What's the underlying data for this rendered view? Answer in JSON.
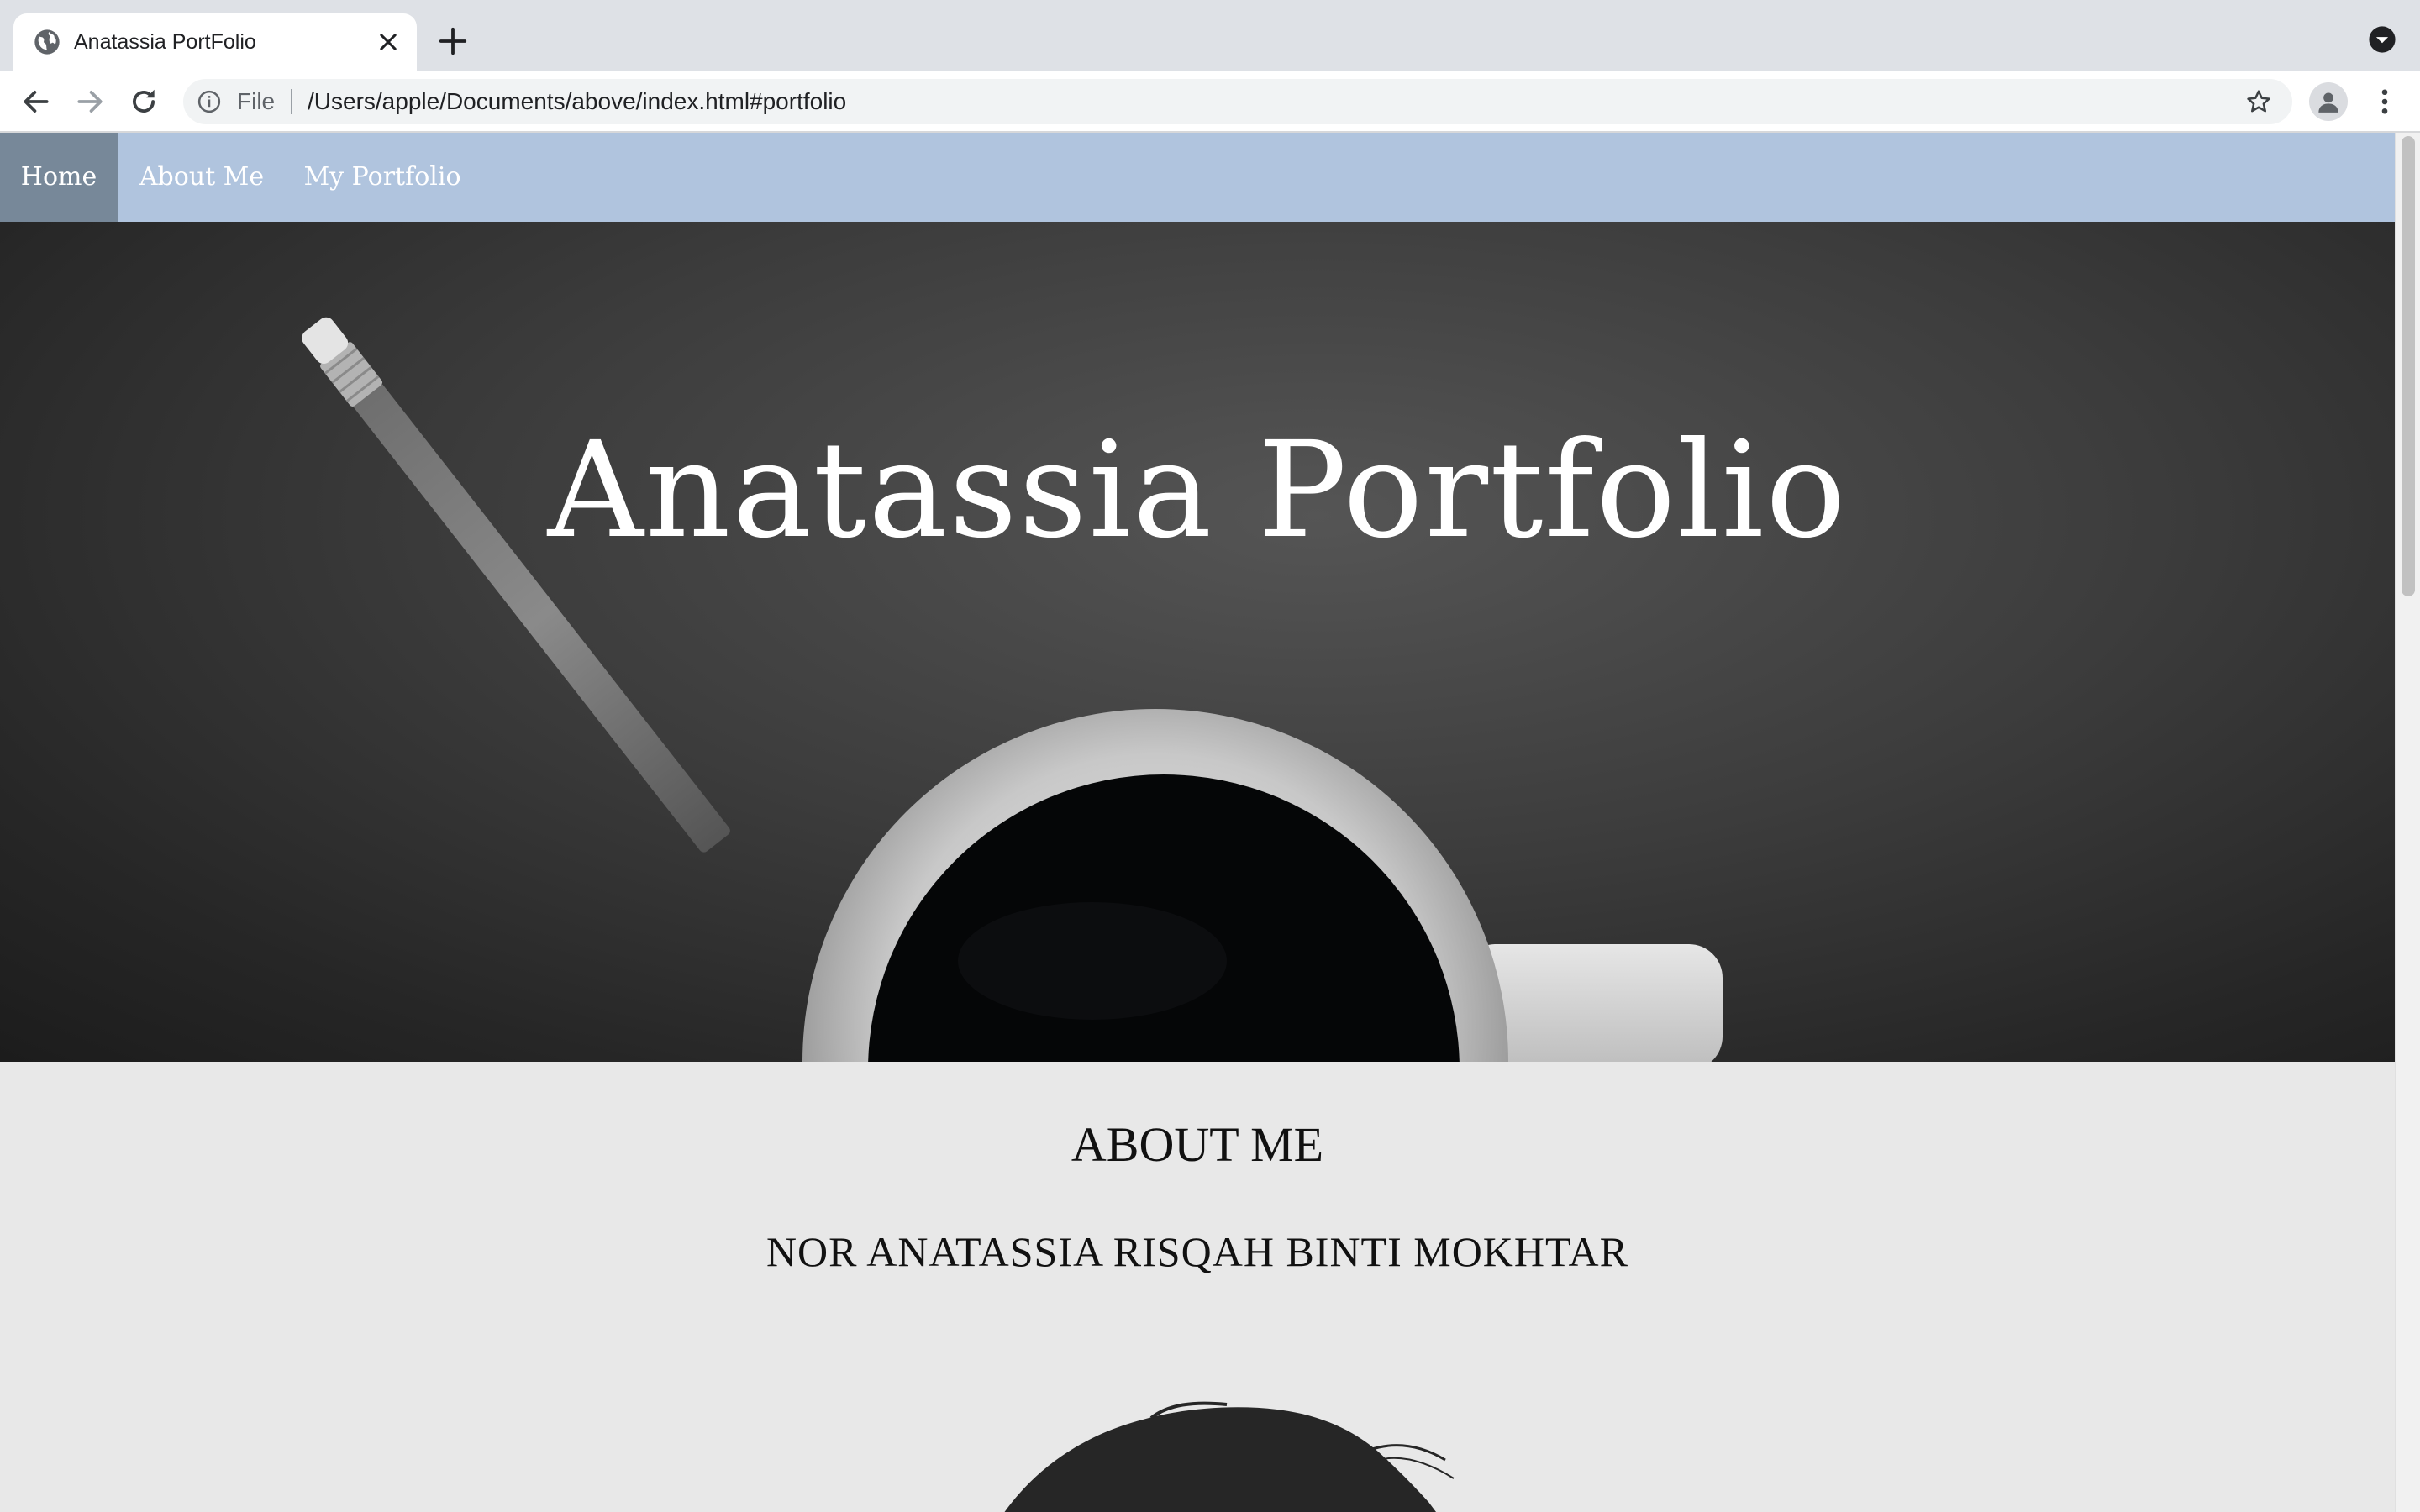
{
  "browser": {
    "tab_title": "Anatassia PortFolio",
    "omnibox_scheme": "File",
    "omnibox_url": "/Users/apple/Documents/above/index.html#portfolio"
  },
  "nav": {
    "items": [
      {
        "label": "Home",
        "active": true
      },
      {
        "label": "About Me",
        "active": false
      },
      {
        "label": "My Portfolio",
        "active": false
      }
    ],
    "bar_color": "#b0c4de",
    "active_color": "#778899"
  },
  "hero": {
    "title": "Anatassia Portfolio"
  },
  "about": {
    "heading": "ABOUT ME",
    "name": "NOR ANATASSIA RISQAH BINTI MOKHTAR"
  },
  "icons": {
    "favicon": "globe-icon",
    "close": "close-icon",
    "new_tab": "plus-icon",
    "back": "back-arrow-icon",
    "forward": "forward-arrow-icon",
    "reload": "reload-icon",
    "info": "info-icon",
    "bookmark": "star-icon",
    "profile": "profile-icon",
    "menu": "kebab-menu-icon",
    "tab_search": "tab-search-icon"
  }
}
